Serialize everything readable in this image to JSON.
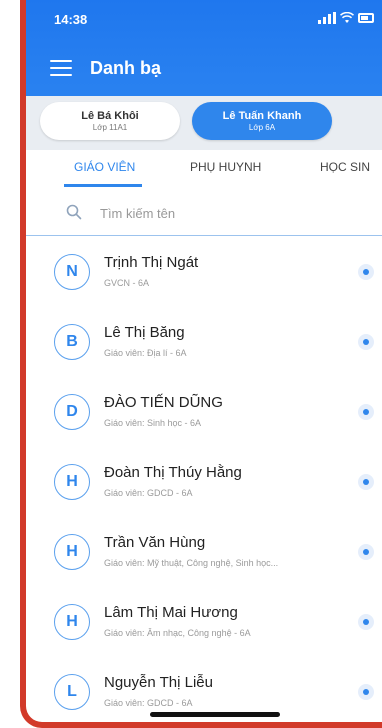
{
  "status": {
    "time": "14:38"
  },
  "header": {
    "title": "Danh bạ"
  },
  "students": [
    {
      "name": "Lê Bá Khôi",
      "class": "Lớp 11A1"
    },
    {
      "name": "Lê Tuấn Khanh",
      "class": "Lớp 6A"
    }
  ],
  "tabs": [
    {
      "label": "GIÁO VIÊN"
    },
    {
      "label": "PHỤ HUYNH"
    },
    {
      "label": "HỌC SIN"
    }
  ],
  "search": {
    "placeholder": "Tìm kiếm tên"
  },
  "contacts": [
    {
      "initial": "N",
      "name": "Trịnh Thị Ngát",
      "detail": "GVCN - 6A"
    },
    {
      "initial": "B",
      "name": "Lê Thị Băng",
      "detail": "Giáo viên: Địa lí - 6A"
    },
    {
      "initial": "D",
      "name": "ĐÀO TIẾN DŨNG",
      "detail": "Giáo viên: Sinh học - 6A"
    },
    {
      "initial": "H",
      "name": "Đoàn Thị Thúy Hằng",
      "detail": "Giáo viên: GDCD - 6A"
    },
    {
      "initial": "H",
      "name": "Trần Văn Hùng",
      "detail": "Giáo viên: Mỹ thuật, Công nghệ, Sinh học..."
    },
    {
      "initial": "H",
      "name": "Lâm Thị Mai Hương",
      "detail": "Giáo viên: Âm nhạc, Công nghệ - 6A"
    },
    {
      "initial": "L",
      "name": "Nguyễn Thị Liễu",
      "detail": "Giáo viên: GDCD - 6A"
    }
  ],
  "colors": {
    "primary": "#2f86ec",
    "frame": "#d23a2a"
  }
}
